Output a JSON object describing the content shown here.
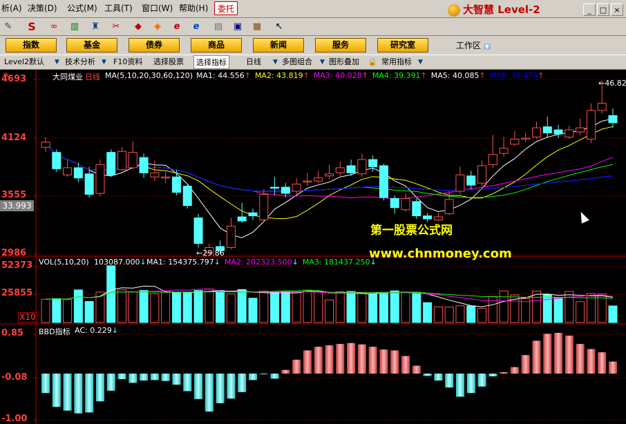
{
  "menubar": {
    "items": [
      "析(A)",
      "决策(D)",
      "公式(M)",
      "工具(T)",
      "窗口(W)",
      "帮助(H)"
    ],
    "entrust": "委托",
    "brand": "大智慧 Level-2",
    "win_buttons": [
      "_",
      "□",
      "×"
    ]
  },
  "toolbar": {
    "icons": [
      "ruler-icon",
      "s-icon",
      "glasses-icon",
      "bars-icon",
      "tower-icon",
      "pin-icon",
      "diamond-icon",
      "e-icon",
      "globe-icon",
      "notepad-icon",
      "window-icon",
      "books-icon",
      "pointer-help-icon"
    ]
  },
  "nav": {
    "buttons": [
      "指数",
      "基金",
      "债券",
      "商品",
      "新闻",
      "服务",
      "研究室"
    ],
    "workspace": "工作区"
  },
  "tabs": {
    "items": [
      "Level2默认",
      "技术分析",
      "F10资料",
      "选择股票",
      "选择指标",
      "日线",
      "多图组合",
      "图形叠加",
      "常用指标"
    ]
  },
  "main": {
    "title": "大同煤业",
    "period": "日线",
    "ma_params": "MA(5,10,20,30,60,120)",
    "ma_values": [
      {
        "label": "MA1:",
        "value": "44.556",
        "color": "#ffffff"
      },
      {
        "label": "MA2:",
        "value": "43.819",
        "color": "#ffff00"
      },
      {
        "label": "MA3:",
        "value": "40.028",
        "color": "#ff00ff"
      },
      {
        "label": "MA4:",
        "value": "39.391",
        "color": "#00ff00"
      },
      {
        "label": "MA5:",
        "value": "40.085",
        "color": "#ffffff"
      },
      {
        "label": "MA6:",
        "value": "38.474",
        "color": "#0000ff"
      }
    ],
    "y_labels": [
      "4693",
      "4124",
      "3555",
      "2986"
    ],
    "current_price": "33.993",
    "high_marker": "46.82",
    "low_marker": "29.86"
  },
  "volume": {
    "params": "VOL(5,10,20)",
    "value": "103087.000",
    "ma_values": [
      {
        "label": "MA1:",
        "value": "154375.797",
        "color": "#ffffff"
      },
      {
        "label": "MA2:",
        "value": "202323.500",
        "color": "#ff00ff"
      },
      {
        "label": "MA3:",
        "value": "181437.250",
        "color": "#00ff00"
      }
    ],
    "y_labels": [
      "52373",
      "25855"
    ],
    "multiplier": "X10"
  },
  "bbd": {
    "title": "BBD指标",
    "ac_label": "AC:",
    "ac_value": "0.229",
    "y_labels": [
      "0.85",
      "-0.08",
      "-1.00"
    ]
  },
  "watermark": {
    "line1": "第一股票公式网",
    "line2": "www.chnmoney.com"
  },
  "colors": {
    "up": "#ff5050",
    "down": "#54ffff",
    "axis": "#c00000",
    "ma1": "#ffffff",
    "ma2": "#ffff00",
    "ma3": "#ff00ff",
    "ma4": "#00ff00",
    "ma5": "#c0c0c0",
    "ma6": "#0000ff"
  },
  "chart_data": {
    "type": "candlestick",
    "candles": [
      {
        "o": 40.3,
        "c": 40.8,
        "h": 41.3,
        "l": 39.8
      },
      {
        "o": 39.8,
        "c": 38.2,
        "h": 40.1,
        "l": 37.9
      },
      {
        "o": 37.6,
        "c": 38.3,
        "h": 39.1,
        "l": 37.4
      },
      {
        "o": 38.3,
        "c": 37.3,
        "h": 38.8,
        "l": 36.9
      },
      {
        "o": 37.7,
        "c": 35.7,
        "h": 38.4,
        "l": 35.4
      },
      {
        "o": 35.8,
        "c": 38.6,
        "h": 39.1,
        "l": 35.5
      },
      {
        "o": 39.8,
        "c": 37.6,
        "h": 40.1,
        "l": 37.4
      },
      {
        "o": 38.1,
        "c": 39.9,
        "h": 40.3,
        "l": 38.0
      },
      {
        "o": 38.3,
        "c": 39.8,
        "h": 40.9,
        "l": 38.1
      },
      {
        "o": 39.3,
        "c": 37.8,
        "h": 39.7,
        "l": 37.3
      },
      {
        "o": 37.4,
        "c": 37.8,
        "h": 39.0,
        "l": 37.0
      },
      {
        "o": 37.3,
        "c": 37.4,
        "h": 37.9,
        "l": 36.8
      },
      {
        "o": 37.4,
        "c": 35.9,
        "h": 38.1,
        "l": 35.6
      },
      {
        "o": 36.5,
        "c": 34.6,
        "h": 36.7,
        "l": 34.3
      },
      {
        "o": 33.4,
        "c": 30.9,
        "h": 33.8,
        "l": 30.5
      },
      {
        "o": 30.0,
        "c": 30.5,
        "h": 30.9,
        "l": 29.9
      },
      {
        "o": 30.6,
        "c": 30.2,
        "h": 31.2,
        "l": 29.86
      },
      {
        "o": 30.5,
        "c": 32.6,
        "h": 33.4,
        "l": 30.3
      },
      {
        "o": 33.5,
        "c": 33.1,
        "h": 34.9,
        "l": 32.9
      },
      {
        "o": 33.9,
        "c": 33.6,
        "h": 34.3,
        "l": 33.2
      },
      {
        "o": 33.2,
        "c": 35.7,
        "h": 36.2,
        "l": 33.0
      },
      {
        "o": 36.4,
        "c": 36.3,
        "h": 37.4,
        "l": 35.6
      },
      {
        "o": 36.4,
        "c": 35.8,
        "h": 36.8,
        "l": 35.4
      },
      {
        "o": 36.0,
        "c": 36.7,
        "h": 37.3,
        "l": 35.7
      },
      {
        "o": 36.9,
        "c": 37.0,
        "h": 37.8,
        "l": 36.5
      },
      {
        "o": 37.0,
        "c": 37.3,
        "h": 38.0,
        "l": 36.8
      },
      {
        "o": 37.5,
        "c": 37.7,
        "h": 38.6,
        "l": 37.2
      },
      {
        "o": 37.8,
        "c": 38.3,
        "h": 38.9,
        "l": 37.5
      },
      {
        "o": 38.5,
        "c": 37.8,
        "h": 39.1,
        "l": 37.5
      },
      {
        "o": 37.7,
        "c": 39.1,
        "h": 39.7,
        "l": 37.4
      },
      {
        "o": 39.1,
        "c": 38.4,
        "h": 39.5,
        "l": 37.9
      },
      {
        "o": 38.5,
        "c": 35.4,
        "h": 38.7,
        "l": 35.1
      },
      {
        "o": 35.3,
        "c": 34.4,
        "h": 35.6,
        "l": 33.8
      },
      {
        "o": 34.2,
        "c": 35.3,
        "h": 35.8,
        "l": 34.0
      },
      {
        "o": 35.0,
        "c": 33.6,
        "h": 35.3,
        "l": 33.3
      },
      {
        "o": 33.6,
        "c": 33.3,
        "h": 33.9,
        "l": 33.0
      },
      {
        "o": 33.2,
        "c": 33.5,
        "h": 33.9,
        "l": 33.1
      },
      {
        "o": 33.8,
        "c": 35.2,
        "h": 36.0,
        "l": 33.7
      },
      {
        "o": 36.0,
        "c": 37.6,
        "h": 38.4,
        "l": 35.7
      },
      {
        "o": 37.5,
        "c": 36.6,
        "h": 38.0,
        "l": 36.2
      },
      {
        "o": 36.8,
        "c": 38.5,
        "h": 39.0,
        "l": 36.5
      },
      {
        "o": 38.6,
        "c": 39.6,
        "h": 41.5,
        "l": 38.3
      },
      {
        "o": 39.7,
        "c": 40.2,
        "h": 41.3,
        "l": 39.4
      },
      {
        "o": 40.6,
        "c": 41.1,
        "h": 41.9,
        "l": 40.4
      },
      {
        "o": 41.1,
        "c": 41.2,
        "h": 41.7,
        "l": 40.8
      },
      {
        "o": 41.3,
        "c": 42.2,
        "h": 42.8,
        "l": 41.1
      },
      {
        "o": 42.3,
        "c": 41.7,
        "h": 43.3,
        "l": 41.3
      },
      {
        "o": 42.0,
        "c": 41.6,
        "h": 42.5,
        "l": 41.2
      },
      {
        "o": 41.3,
        "c": 42.0,
        "h": 42.4,
        "l": 41.1
      },
      {
        "o": 41.8,
        "c": 42.2,
        "h": 43.1,
        "l": 41.5
      },
      {
        "o": 41.1,
        "c": 43.9,
        "h": 44.6,
        "l": 40.7
      },
      {
        "o": 43.9,
        "c": 44.6,
        "h": 46.82,
        "l": 43.6
      },
      {
        "o": 43.4,
        "c": 42.7,
        "h": 44.1,
        "l": 42.2
      }
    ],
    "volume": [
      12100,
      12400,
      11900,
      16900,
      10900,
      15800,
      29400,
      16900,
      15900,
      16600,
      14900,
      15600,
      15700,
      15600,
      16600,
      17300,
      16600,
      14800,
      17100,
      12600,
      16200,
      15800,
      16000,
      15900,
      16800,
      15900,
      11700,
      15900,
      16100,
      15400,
      14900,
      15500,
      16400,
      15800,
      15700,
      10300,
      8100,
      8000,
      8700,
      8600,
      7400,
      13500,
      16400,
      14300,
      12400,
      16300,
      14500,
      12700,
      16100,
      10800,
      15000,
      14800,
      8600
    ],
    "volume_up": [
      true,
      false,
      true,
      false,
      false,
      true,
      false,
      true,
      true,
      false,
      true,
      true,
      false,
      false,
      false,
      true,
      false,
      true,
      false,
      false,
      true,
      false,
      false,
      true,
      true,
      true,
      true,
      true,
      false,
      true,
      false,
      false,
      false,
      true,
      false,
      false,
      true,
      true,
      true,
      false,
      true,
      true,
      true,
      true,
      true,
      true,
      false,
      false,
      true,
      true,
      true,
      true,
      false
    ],
    "bbd": [
      -0.42,
      -0.72,
      -0.8,
      -0.86,
      -0.84,
      -0.6,
      -0.37,
      -0.12,
      -0.2,
      -0.15,
      -0.14,
      -0.16,
      -0.24,
      -0.38,
      -0.55,
      -0.82,
      -0.64,
      -0.54,
      -0.4,
      -0.14,
      -0.01,
      -0.11,
      0.08,
      0.3,
      0.5,
      0.58,
      0.61,
      0.64,
      0.66,
      0.63,
      0.58,
      0.52,
      0.5,
      0.38,
      0.17,
      -0.05,
      -0.15,
      -0.3,
      -0.5,
      -0.42,
      -0.28,
      -0.06,
      0.03,
      0.14,
      0.4,
      0.71,
      0.86,
      0.88,
      0.82,
      0.64,
      0.53,
      0.46,
      0.26
    ],
    "y_ticks": [
      "4693",
      "4124",
      "3555",
      "2986"
    ],
    "ylim": [
      29.86,
      46.93
    ]
  }
}
